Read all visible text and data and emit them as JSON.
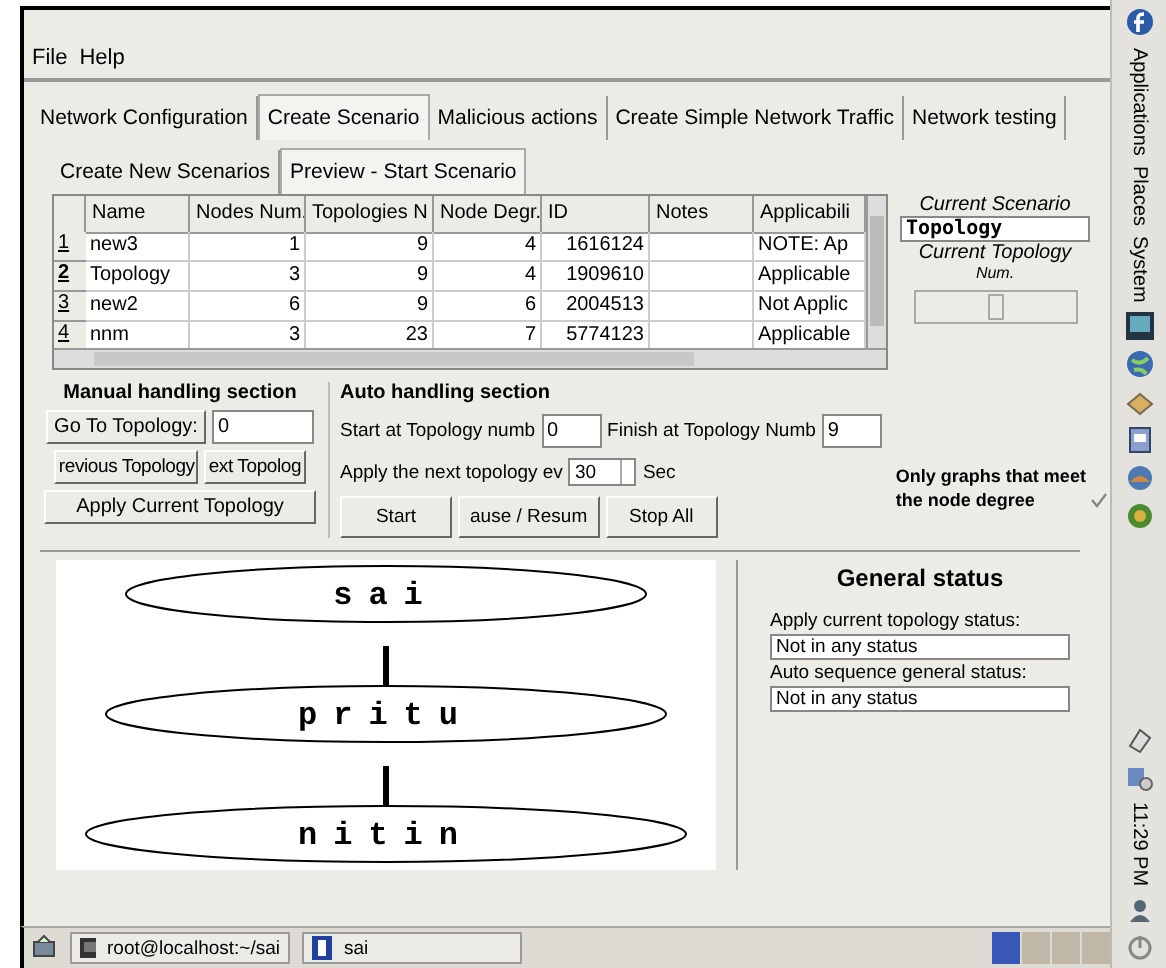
{
  "menu": [
    "File",
    "Help"
  ],
  "tabs": [
    {
      "label": "Network Configuration",
      "selected": false
    },
    {
      "label": "Create Scenario",
      "selected": true
    },
    {
      "label": "Malicious actions",
      "selected": false
    },
    {
      "label": "Create Simple Network Traffic",
      "selected": false
    },
    {
      "label": "Network testing",
      "selected": false
    }
  ],
  "subtabs": [
    {
      "label": "Create New Scenarios",
      "selected": false
    },
    {
      "label": "Preview - Start Scenario",
      "selected": true
    }
  ],
  "table": {
    "columns": [
      "Name",
      "Nodes Num.",
      "Topologies N",
      "Node Degr.",
      "ID",
      "Notes",
      "Applicabili"
    ],
    "rows": [
      {
        "number": "1",
        "selected": false,
        "cells": [
          "new3",
          "1",
          "9",
          "4",
          "1616124",
          "",
          "NOTE: Ap"
        ]
      },
      {
        "number": "2",
        "selected": true,
        "cells": [
          "Topology",
          "3",
          "9",
          "4",
          "1909610",
          "",
          "Applicable"
        ]
      },
      {
        "number": "3",
        "selected": false,
        "cells": [
          "new2",
          "6",
          "9",
          "6",
          "2004513",
          "",
          "Not Applic"
        ]
      },
      {
        "number": "4",
        "selected": false,
        "cells": [
          "nnm",
          "3",
          "23",
          "7",
          "5774123",
          "",
          "Applicable"
        ]
      }
    ]
  },
  "current_scenario": {
    "title": "Current Scenario",
    "value": "Topology",
    "topology_label": "Current Topology",
    "num_label": "Num."
  },
  "manual": {
    "title": "Manual handling section",
    "goto_button": "Go To Topology:",
    "goto_value": "0",
    "prev_button": "revious Topology",
    "next_button": "ext Topolog",
    "apply_button": "Apply Current Topology"
  },
  "auto": {
    "title": "Auto handling section",
    "start_label": "Start at Topology numb",
    "start_value": "0",
    "finish_label": "Finish at Topology Numb",
    "finish_value": "9",
    "interval_label": "Apply the next topology ev",
    "interval_value": "30",
    "interval_unit": "Sec",
    "buttons": [
      "Start",
      "ause / Resum",
      "Stop All"
    ]
  },
  "node_degree_option": {
    "label": "Only graphs that meet the node degree",
    "checked": true
  },
  "graph": {
    "nodes": [
      "sai",
      "pritu",
      "nitin"
    ]
  },
  "status": {
    "title": "General status",
    "apply_label": "Apply current topology status:",
    "apply_value": "Not in any status",
    "auto_label": "Auto sequence general status:",
    "auto_value": "Not in any status"
  },
  "taskbar": [
    {
      "label": "root@localhost:~/sai",
      "kind": "terminal"
    },
    {
      "label": "sai",
      "kind": "java"
    }
  ],
  "panel": {
    "menus": [
      "Applications",
      "Places",
      "System"
    ],
    "clock": "11:29 PM"
  }
}
